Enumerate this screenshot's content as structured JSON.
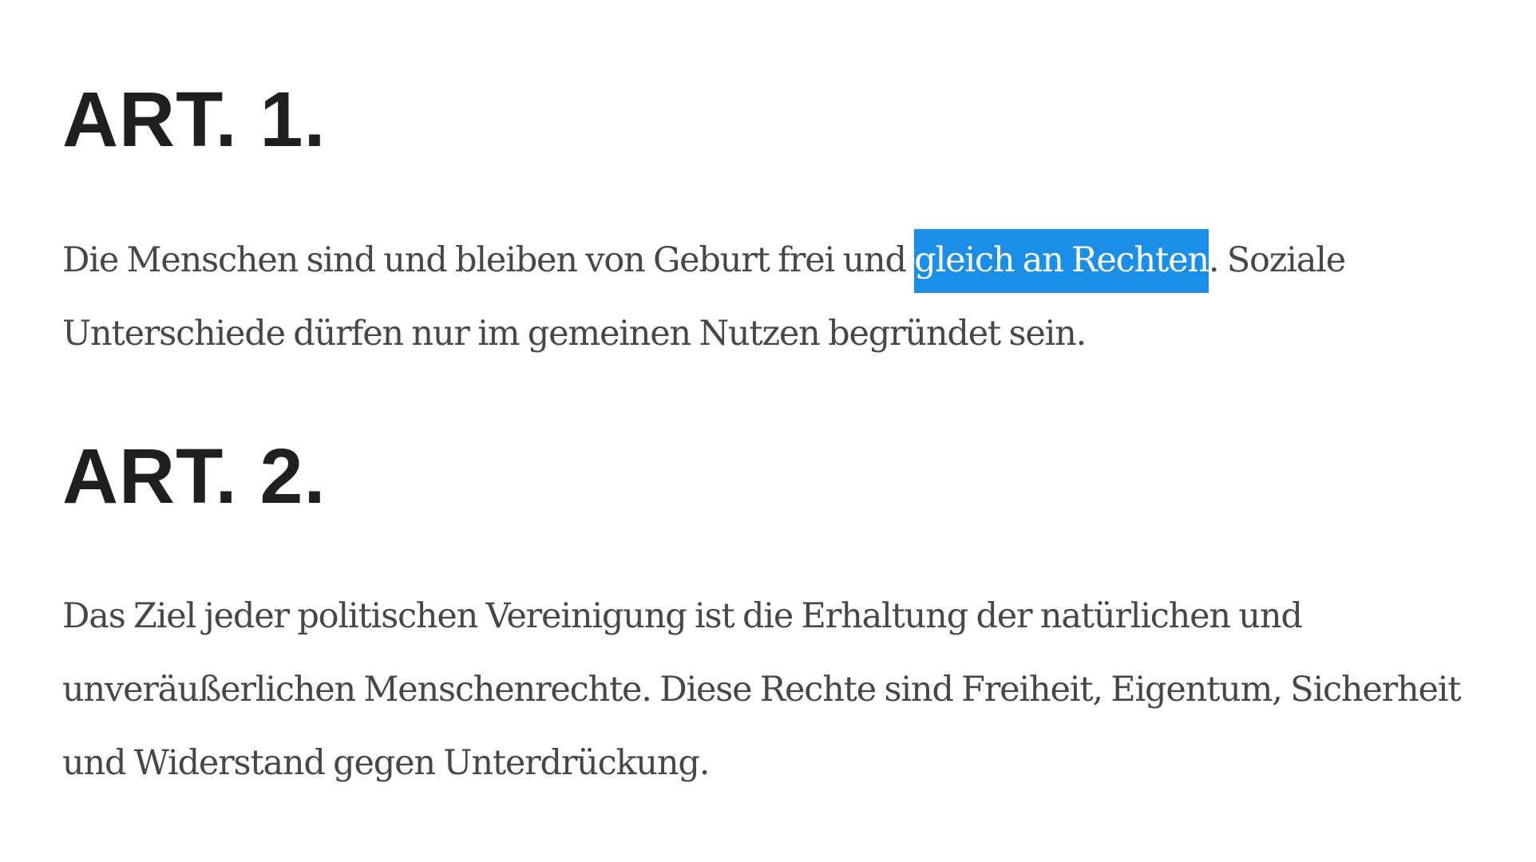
{
  "articles": [
    {
      "heading": "ART. 1.",
      "lines": [
        {
          "before": "Die Menschen sind und bleiben von Geburt frei und ",
          "highlight": "gleich an Rechten",
          "after": ". Soziale"
        },
        {
          "text": "Unterschiede dürfen nur im gemeinen Nutzen begründet sein."
        }
      ]
    },
    {
      "heading": "ART. 2.",
      "lines": [
        {
          "text": "Das Ziel jeder politischen Vereinigung ist die Erhaltung der natürlichen und"
        },
        {
          "text": "unveräußerlichen Menschenrechte. Diese Rechte sind Freiheit, Eigentum, Sicherheit"
        },
        {
          "text": "und Widerstand gegen Unterdrückung."
        }
      ]
    }
  ],
  "colors": {
    "heading": "#1f1f1f",
    "body": "#474747",
    "selection_background": "#1a8fe8",
    "selection_text": "#ffffff"
  }
}
